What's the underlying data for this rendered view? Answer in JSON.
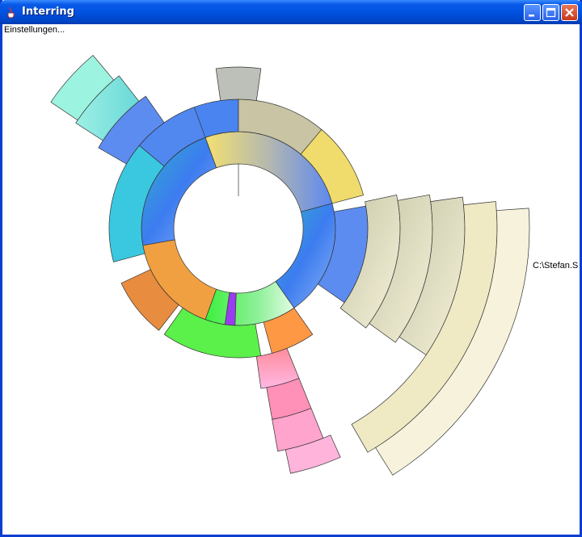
{
  "window": {
    "title": "Interring",
    "icon": "java-cup-icon"
  },
  "menu": {
    "settings_label": "Einstellungen..."
  },
  "hover_label": "C:\\Stefan.S",
  "controls": [
    "minimize-icon",
    "maximize-icon",
    "close-icon"
  ],
  "colors": {
    "titlebar": "#0052e0",
    "center_green": "#5cf04a",
    "blue": "#4a7cf0",
    "beige": "#e6dfb4",
    "pink": "#ff9ec8",
    "cyan": "#7ee6d6",
    "orange": "#ffa040",
    "purple": "#9a3cf0"
  }
}
